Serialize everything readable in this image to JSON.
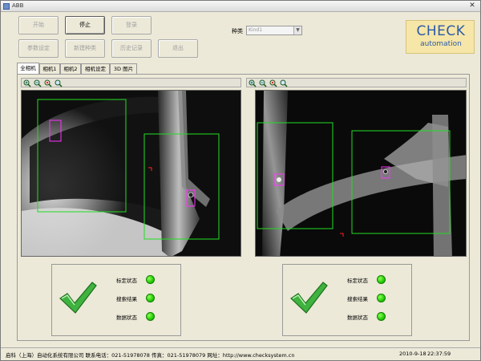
{
  "window": {
    "title": "ABB"
  },
  "toolbar": {
    "start_label": "开始",
    "stop_label": "停止",
    "login_label": "登录",
    "params_label": "参数设定",
    "newtype_label": "新建种类",
    "history_label": "历史记录",
    "exit_label": "退出"
  },
  "kind": {
    "label": "种类",
    "value": "Kind1"
  },
  "logo": {
    "line1": "CHECK",
    "line2": "automation"
  },
  "tabs": [
    {
      "label": "全相机"
    },
    {
      "label": "相机1"
    },
    {
      "label": "相机2"
    },
    {
      "label": "相机设定"
    },
    {
      "label": "3D 图片"
    }
  ],
  "status_panels": [
    {
      "rows": [
        {
          "label": "标定状态"
        },
        {
          "label": "搜索结果"
        },
        {
          "label": "数据状态"
        }
      ]
    },
    {
      "rows": [
        {
          "label": "标定状态"
        },
        {
          "label": "搜索结果"
        },
        {
          "label": "数据状态"
        }
      ]
    }
  ],
  "status": {
    "company": "启科（上海）自动化系统有限公司  联系电话：021-51978078 传真：021-51978079 网址：http://www.checksystem.cn",
    "date": "2010-9-18",
    "time": "22:37:59"
  },
  "icons": {
    "zoom_in": "zoom-in-icon",
    "zoom_out": "zoom-out-icon",
    "zoom_fit": "zoom-fit-icon",
    "zoom_reset": "zoom-reset-icon",
    "check": "check-mark-icon",
    "status_dot": "status-led-icon"
  },
  "colors": {
    "status_ok": "#22cc00",
    "roi_box": "#22dd22",
    "marker": "#ff00ff",
    "logo_bg": "#f6e6a8",
    "logo_text": "#2a5aa8"
  }
}
